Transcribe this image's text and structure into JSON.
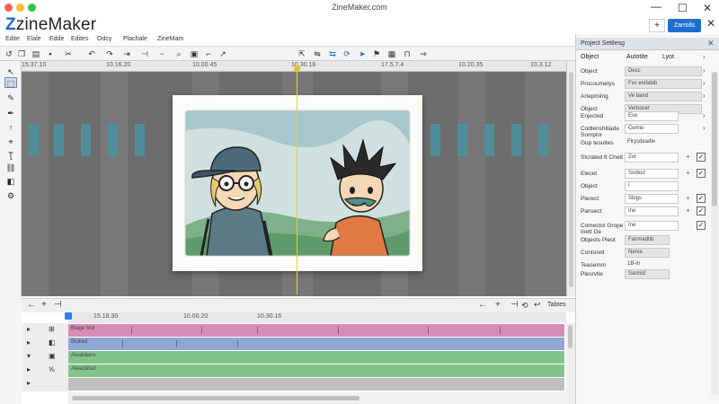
{
  "window": {
    "title": "ZineMaker.com"
  },
  "app": {
    "logo_z": "Z",
    "logo_rest": "zineMaker"
  },
  "top_right": {
    "add_label": "+",
    "primary_label": "Zarrolls"
  },
  "menu": [
    "Edite",
    "Elale",
    "Edde",
    "Edites",
    "Odcy",
    "Plachale",
    "ZineMam"
  ],
  "ruler": [
    "15.37.10",
    "10.16.20",
    "10.00.45",
    "10.30.18",
    "17.5.7.4",
    "10.20.35",
    "10.3.12"
  ],
  "timeline": {
    "ruler": [
      "15.18.30",
      "10.00.20",
      "10.30.16"
    ],
    "tabs_label": "Tabtes",
    "tracks": [
      {
        "label": "Biage blot",
        "color": "#d98bb8"
      },
      {
        "label": "Bloked",
        "color": "#8ea6d6"
      },
      {
        "label": "Alealidans",
        "color": "#82c38a"
      },
      {
        "label": "Alealdidan",
        "color": "#82c38a"
      }
    ]
  },
  "panel": {
    "header": "Project Settlesg",
    "tabs": [
      "Autotite",
      "Lyot"
    ],
    "rows": [
      {
        "label": "Object",
        "value": ""
      },
      {
        "label": "Object",
        "value": "Desc"
      },
      {
        "label": "Procoumetys",
        "value": "Fvc enifabib"
      },
      {
        "label": "Arlepmiing",
        "value": "Ve band"
      },
      {
        "label": "Object",
        "value": "Verbocet"
      },
      {
        "label": "Enjected",
        "value": "Ese"
      },
      {
        "label": "Codlenshitiade Somplor",
        "value": "Cemie"
      },
      {
        "label": "Gup tesultes",
        "value": "Flrysdeadle"
      },
      {
        "label": "Stcrated ft Chett",
        "value": "Zor"
      },
      {
        "label": "Elecet",
        "value": "Sodiod"
      },
      {
        "label": "Object",
        "value": "I"
      },
      {
        "label": "Plerect",
        "value": "Sbigs"
      },
      {
        "label": "Pansect",
        "value": "Ine"
      },
      {
        "label": "Comectoi Grope Inett Ge",
        "value": "Ine"
      },
      {
        "label": "Objects Pleot",
        "value": "Fanmadtib"
      },
      {
        "label": "Contorett",
        "value": "Nenia"
      },
      {
        "label": "Teasemm",
        "value": "1B-in"
      },
      {
        "label": "Plesrvtie",
        "value": "Sarmid"
      }
    ]
  }
}
